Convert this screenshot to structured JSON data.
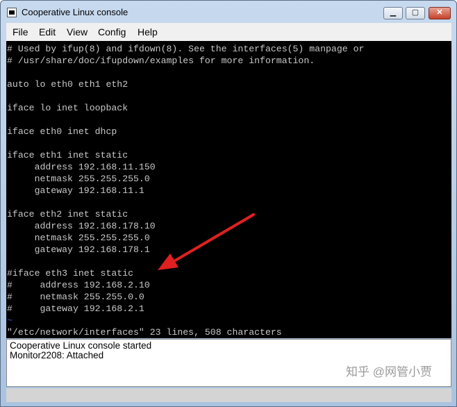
{
  "window": {
    "title": "Cooperative Linux console",
    "buttons": {
      "minimize": "▁",
      "maximize": "▢",
      "close": "✕"
    }
  },
  "menu": [
    "File",
    "Edit",
    "View",
    "Config",
    "Help"
  ],
  "terminal": {
    "lines": [
      "# Used by ifup(8) and ifdown(8). See the interfaces(5) manpage or",
      "# /usr/share/doc/ifupdown/examples for more information.",
      "",
      "auto lo eth0 eth1 eth2",
      "",
      "iface lo inet loopback",
      "",
      "iface eth0 inet dhcp",
      "",
      "iface eth1 inet static",
      "     address 192.168.11.150",
      "     netmask 255.255.255.0",
      "     gateway 192.168.11.1",
      "",
      "iface eth2 inet static",
      "     address 192.168.178.10",
      "     netmask 255.255.255.0",
      "     gateway 192.168.178.1",
      "",
      "#iface eth3 inet static",
      "#     address 192.168.2.10",
      "#     netmask 255.255.0.0",
      "#     gateway 192.168.2.1",
      "~",
      "\"/etc/network/interfaces\" 23 lines, 508 characters"
    ]
  },
  "log": [
    "Cooperative Linux console started",
    "Monitor2208: Attached"
  ],
  "watermark": "知乎 @网管小贾",
  "colors": {
    "terminal_bg": "#000000",
    "terminal_fg": "#c8c8c8",
    "arrow": "#e02020",
    "tilde": "#3b5fd9"
  }
}
